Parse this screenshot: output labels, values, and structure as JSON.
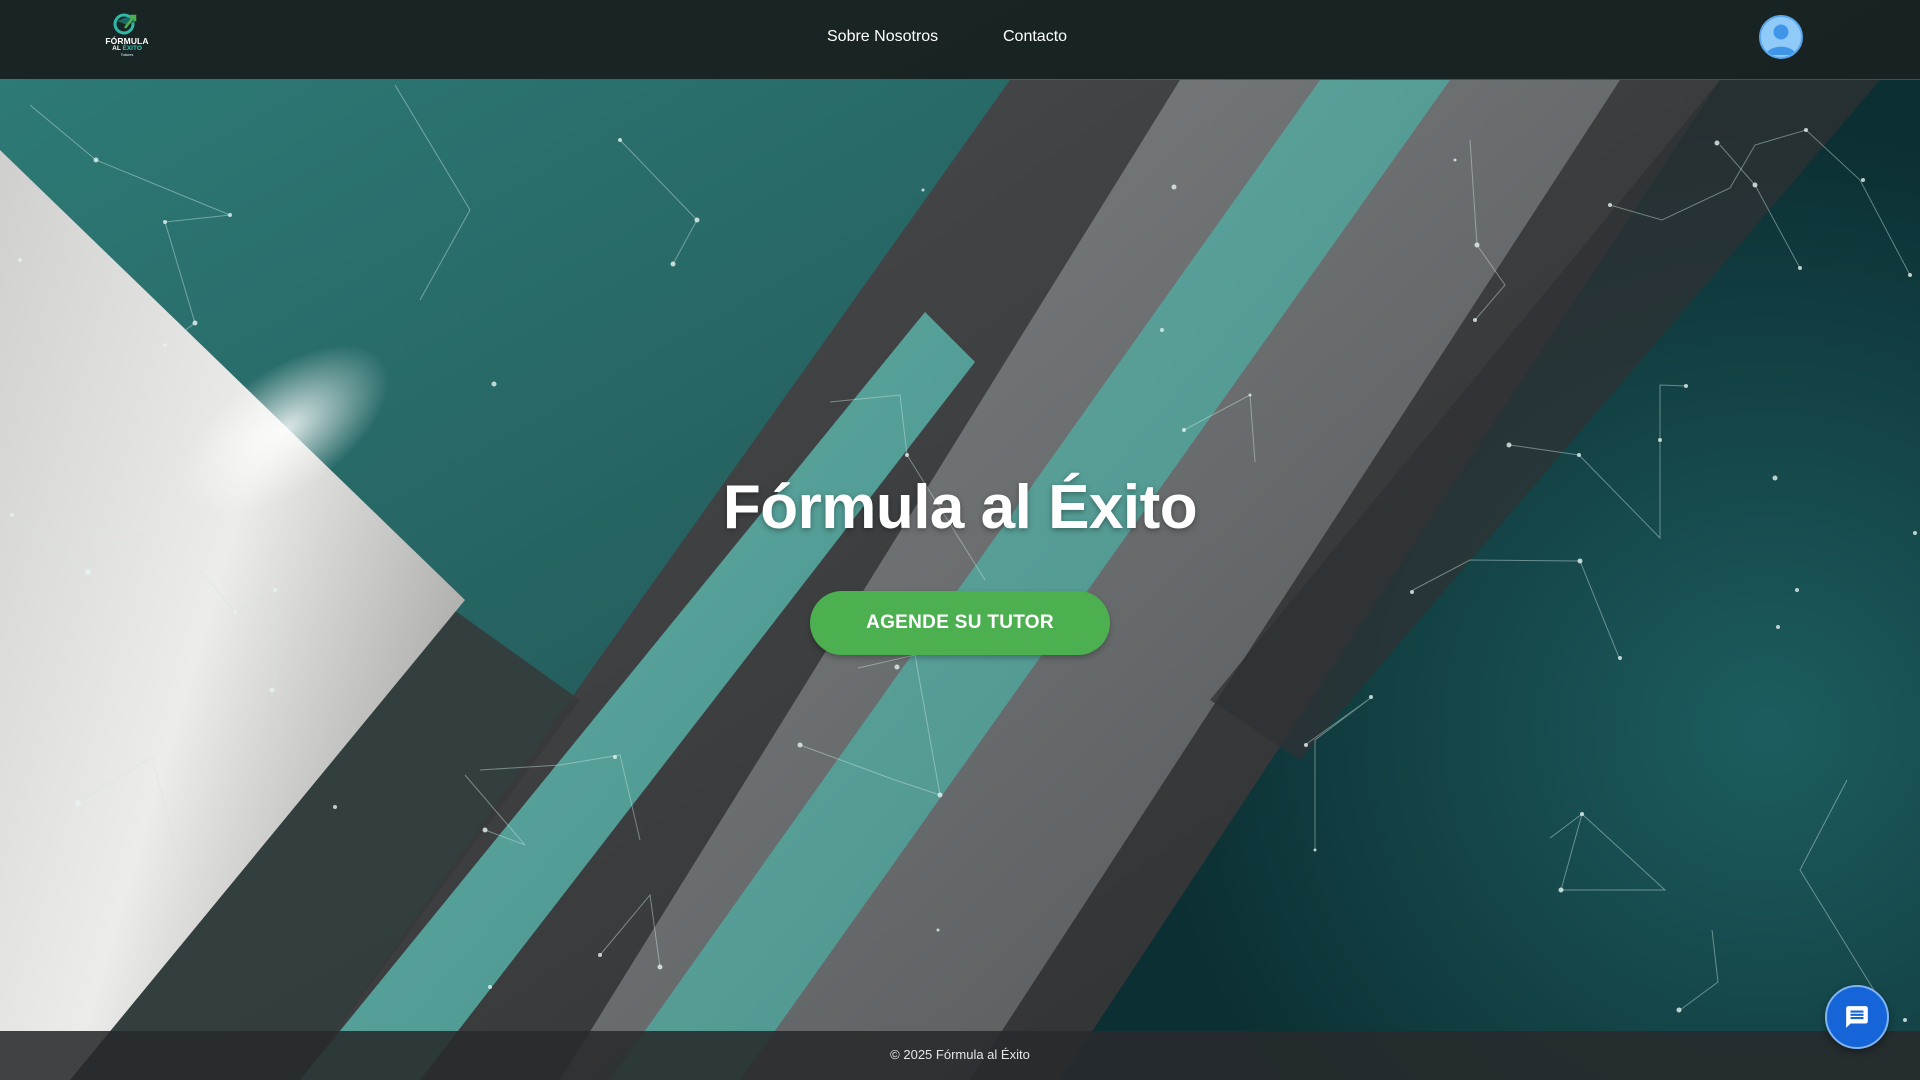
{
  "site": {
    "logo": {
      "line1": "FÓRMULA",
      "line2_prefix": "AL ",
      "line2_accent": "ÉXITO",
      "line3": "Tutores"
    },
    "nav": {
      "about_label": "Sobre Nosotros",
      "contact_label": "Contacto"
    },
    "user_avatar_icon": "user-avatar-icon"
  },
  "hero": {
    "title": "Fórmula al Éxito",
    "cta_label": "AGENDE SU TUTOR"
  },
  "footer": {
    "copyright": "© 2025 Fórmula al Éxito"
  },
  "chat": {
    "icon": "chat-message-icon"
  },
  "colors": {
    "header_bg": "#181e1e",
    "cta_green": "#4caf50",
    "teal": "#2f7a75",
    "avatar_blue": "#90caf9",
    "chat_blue": "#1565d8",
    "footer_bg": "#282a2c"
  }
}
